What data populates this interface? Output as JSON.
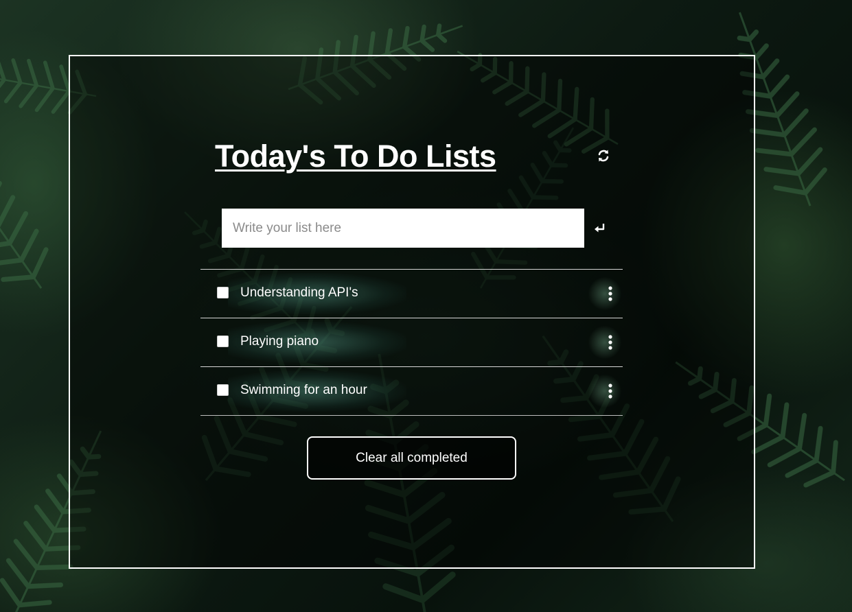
{
  "header": {
    "title": "Today's To Do Lists",
    "refresh_icon": "refresh-icon"
  },
  "input": {
    "placeholder": "Write your list here",
    "value": "",
    "enter_icon": "enter-icon"
  },
  "todos": [
    {
      "label": "Understanding API's",
      "completed": false,
      "menu_icon": "kebab-icon"
    },
    {
      "label": "Playing piano",
      "completed": false,
      "menu_icon": "kebab-icon"
    },
    {
      "label": "Swimming for an hour",
      "completed": false,
      "menu_icon": "kebab-icon"
    }
  ],
  "actions": {
    "clear_label": "Clear all completed"
  },
  "colors": {
    "panel_border": "#ffffff",
    "text": "#ffffff",
    "background": "#0d1a12",
    "fern": "#2f5a38"
  }
}
